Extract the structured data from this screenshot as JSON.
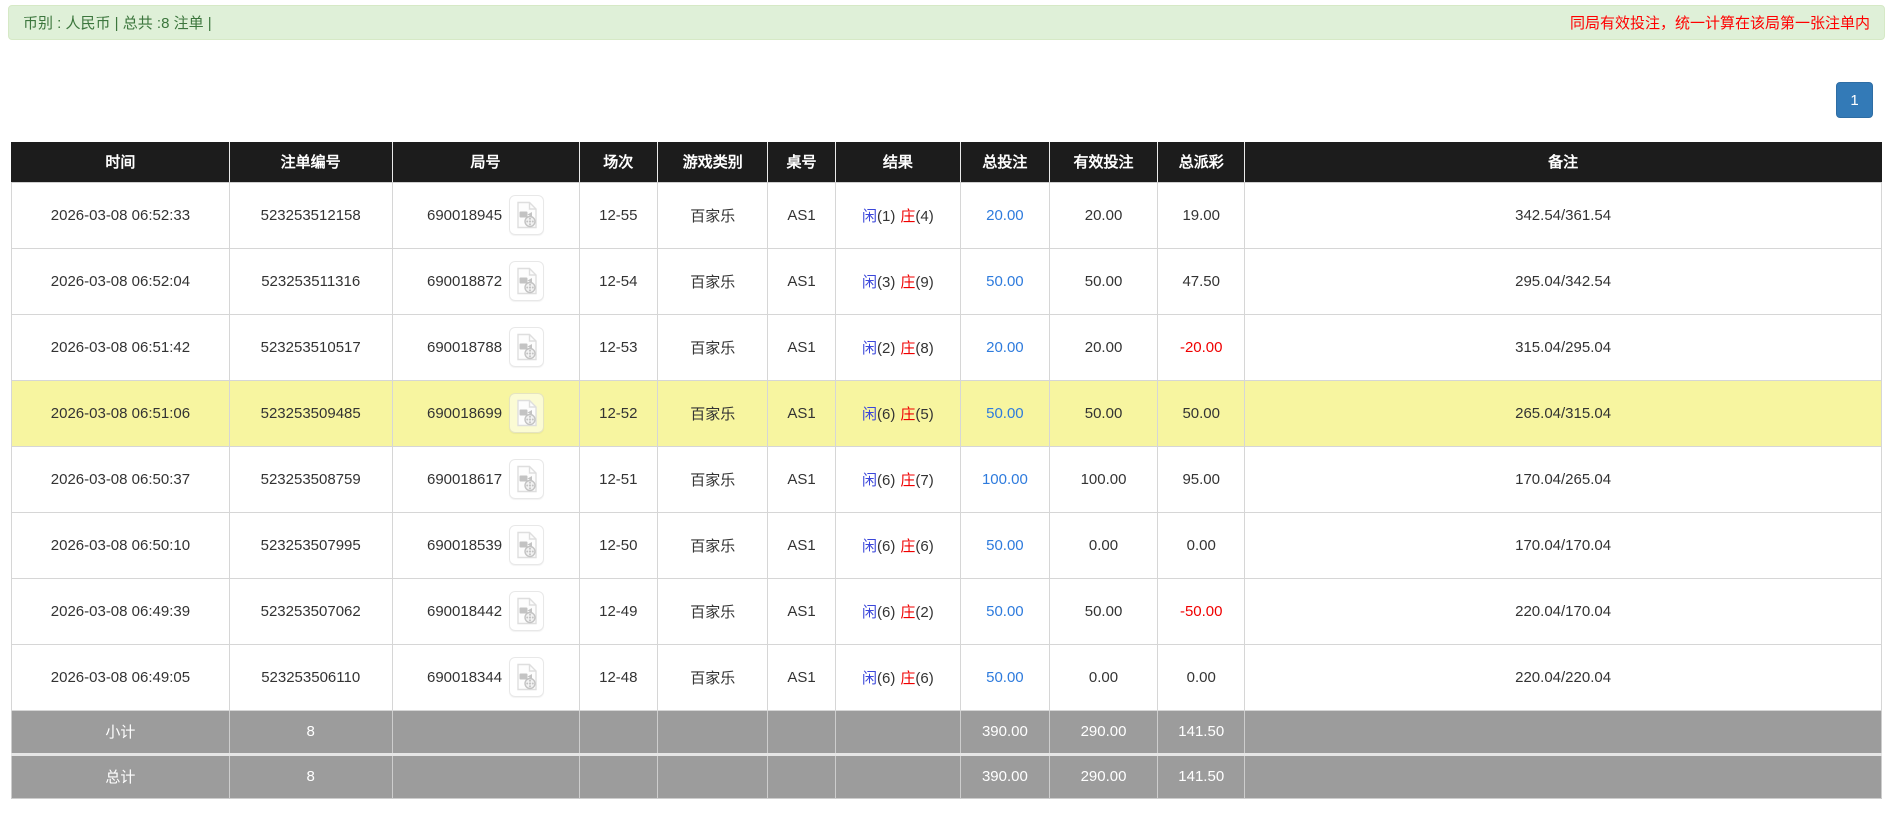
{
  "top_bar": {
    "summary": "币别 : 人民币 | 总共 :8 注单 |",
    "notice": "同局有效投注，统一计算在该局第一张注单内"
  },
  "pagination": {
    "current_page": "1"
  },
  "colors": {
    "summary_bar_bg": "#dff0d8",
    "summary_text_green": "#3c763d",
    "notice_red": "#ff0000",
    "pagination_blue": "#337ab7",
    "header_black": "#1c1c1c",
    "highlight_yellow": "#f7f5a0",
    "player_blue": "#3a46da",
    "banker_red": "#f00000",
    "bet_link_blue": "#2e7bdd",
    "negative_red": "#f00000",
    "footer_gray": "#9c9c9c"
  },
  "icons": {
    "round_video_icon": "video-replay-icon"
  },
  "table": {
    "headers": [
      "时间",
      "注单编号",
      "局号",
      "场次",
      "游戏类别",
      "桌号",
      "结果",
      "总投注",
      "有效投注",
      "总派彩",
      "备注"
    ],
    "rows": [
      {
        "time": "2026-03-08 06:52:33",
        "bet_id": "523253512158",
        "round_id": "690018945",
        "session": "12-55",
        "game": "百家乐",
        "table_no": "AS1",
        "player_label": "闲",
        "player_score": "(1)",
        "banker_label": "庄",
        "banker_score": "(4)",
        "total_bet": "20.00",
        "valid_bet": "20.00",
        "payout": "19.00",
        "remark": "342.54/361.54",
        "highlighted": false
      },
      {
        "time": "2026-03-08 06:52:04",
        "bet_id": "523253511316",
        "round_id": "690018872",
        "session": "12-54",
        "game": "百家乐",
        "table_no": "AS1",
        "player_label": "闲",
        "player_score": "(3)",
        "banker_label": "庄",
        "banker_score": "(9)",
        "total_bet": "50.00",
        "valid_bet": "50.00",
        "payout": "47.50",
        "remark": "295.04/342.54",
        "highlighted": false
      },
      {
        "time": "2026-03-08 06:51:42",
        "bet_id": "523253510517",
        "round_id": "690018788",
        "session": "12-53",
        "game": "百家乐",
        "table_no": "AS1",
        "player_label": "闲",
        "player_score": "(2)",
        "banker_label": "庄",
        "banker_score": "(8)",
        "total_bet": "20.00",
        "valid_bet": "20.00",
        "payout": "-20.00",
        "remark": "315.04/295.04",
        "highlighted": false
      },
      {
        "time": "2026-03-08 06:51:06",
        "bet_id": "523253509485",
        "round_id": "690018699",
        "session": "12-52",
        "game": "百家乐",
        "table_no": "AS1",
        "player_label": "闲",
        "player_score": "(6)",
        "banker_label": "庄",
        "banker_score": "(5)",
        "total_bet": "50.00",
        "valid_bet": "50.00",
        "payout": "50.00",
        "remark": "265.04/315.04",
        "highlighted": true
      },
      {
        "time": "2026-03-08 06:50:37",
        "bet_id": "523253508759",
        "round_id": "690018617",
        "session": "12-51",
        "game": "百家乐",
        "table_no": "AS1",
        "player_label": "闲",
        "player_score": "(6)",
        "banker_label": "庄",
        "banker_score": "(7)",
        "total_bet": "100.00",
        "valid_bet": "100.00",
        "payout": "95.00",
        "remark": "170.04/265.04",
        "highlighted": false
      },
      {
        "time": "2026-03-08 06:50:10",
        "bet_id": "523253507995",
        "round_id": "690018539",
        "session": "12-50",
        "game": "百家乐",
        "table_no": "AS1",
        "player_label": "闲",
        "player_score": "(6)",
        "banker_label": "庄",
        "banker_score": "(6)",
        "total_bet": "50.00",
        "valid_bet": "0.00",
        "payout": "0.00",
        "remark": "170.04/170.04",
        "highlighted": false
      },
      {
        "time": "2026-03-08 06:49:39",
        "bet_id": "523253507062",
        "round_id": "690018442",
        "session": "12-49",
        "game": "百家乐",
        "table_no": "AS1",
        "player_label": "闲",
        "player_score": "(6)",
        "banker_label": "庄",
        "banker_score": "(2)",
        "total_bet": "50.00",
        "valid_bet": "50.00",
        "payout": "-50.00",
        "remark": "220.04/170.04",
        "highlighted": false
      },
      {
        "time": "2026-03-08 06:49:05",
        "bet_id": "523253506110",
        "round_id": "690018344",
        "session": "12-48",
        "game": "百家乐",
        "table_no": "AS1",
        "player_label": "闲",
        "player_score": "(6)",
        "banker_label": "庄",
        "banker_score": "(6)",
        "total_bet": "50.00",
        "valid_bet": "0.00",
        "payout": "0.00",
        "remark": "220.04/220.04",
        "highlighted": false
      }
    ],
    "footer": [
      {
        "label": "小计",
        "count": "8",
        "total_bet": "390.00",
        "valid_bet": "290.00",
        "payout": "141.50"
      },
      {
        "label": "总计",
        "count": "8",
        "total_bet": "390.00",
        "valid_bet": "290.00",
        "payout": "141.50"
      }
    ]
  }
}
